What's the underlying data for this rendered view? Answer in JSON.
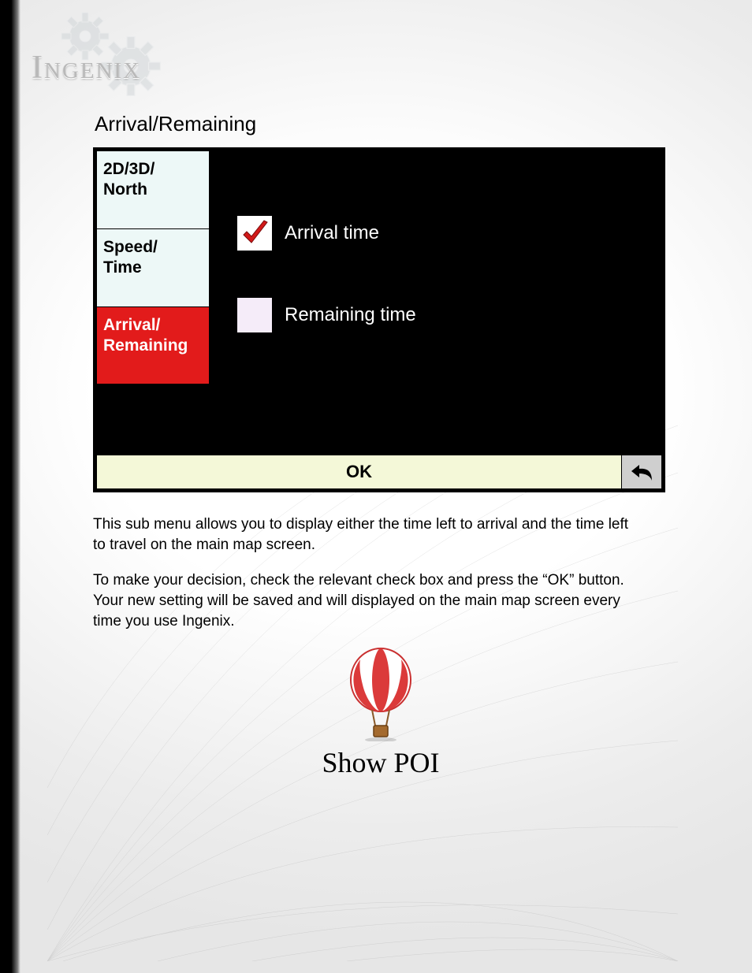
{
  "brand": {
    "name": "Ingenix"
  },
  "section": {
    "title": "Arrival/Remaining"
  },
  "tabs": [
    {
      "label": "2D/3D/\nNorth",
      "active": false
    },
    {
      "label": "Speed/\nTime",
      "active": false
    },
    {
      "label": "Arrival/\nRemaining",
      "active": true
    }
  ],
  "options": {
    "arrival": {
      "label": "Arrival time",
      "checked": true
    },
    "remaining": {
      "label": "Remaining time",
      "checked": false
    }
  },
  "buttons": {
    "ok": "OK",
    "back_icon": "undo-icon"
  },
  "paragraphs": {
    "p1": "This sub menu allows you to display either the time left to arrival and the time left to travel on the main map screen.",
    "p2": "To make your decision, check the relevant check box and press the “OK” button. Your new setting will be saved and will displayed on the main map screen every time you use Ingenix."
  },
  "poi": {
    "label": "Show POI",
    "icon": "hot-air-balloon-icon"
  },
  "colors": {
    "tab_active_bg": "#e21b1b",
    "tab_bg": "#edf8f7",
    "ok_bg": "#f4f8d8",
    "check_red": "#d21919"
  }
}
